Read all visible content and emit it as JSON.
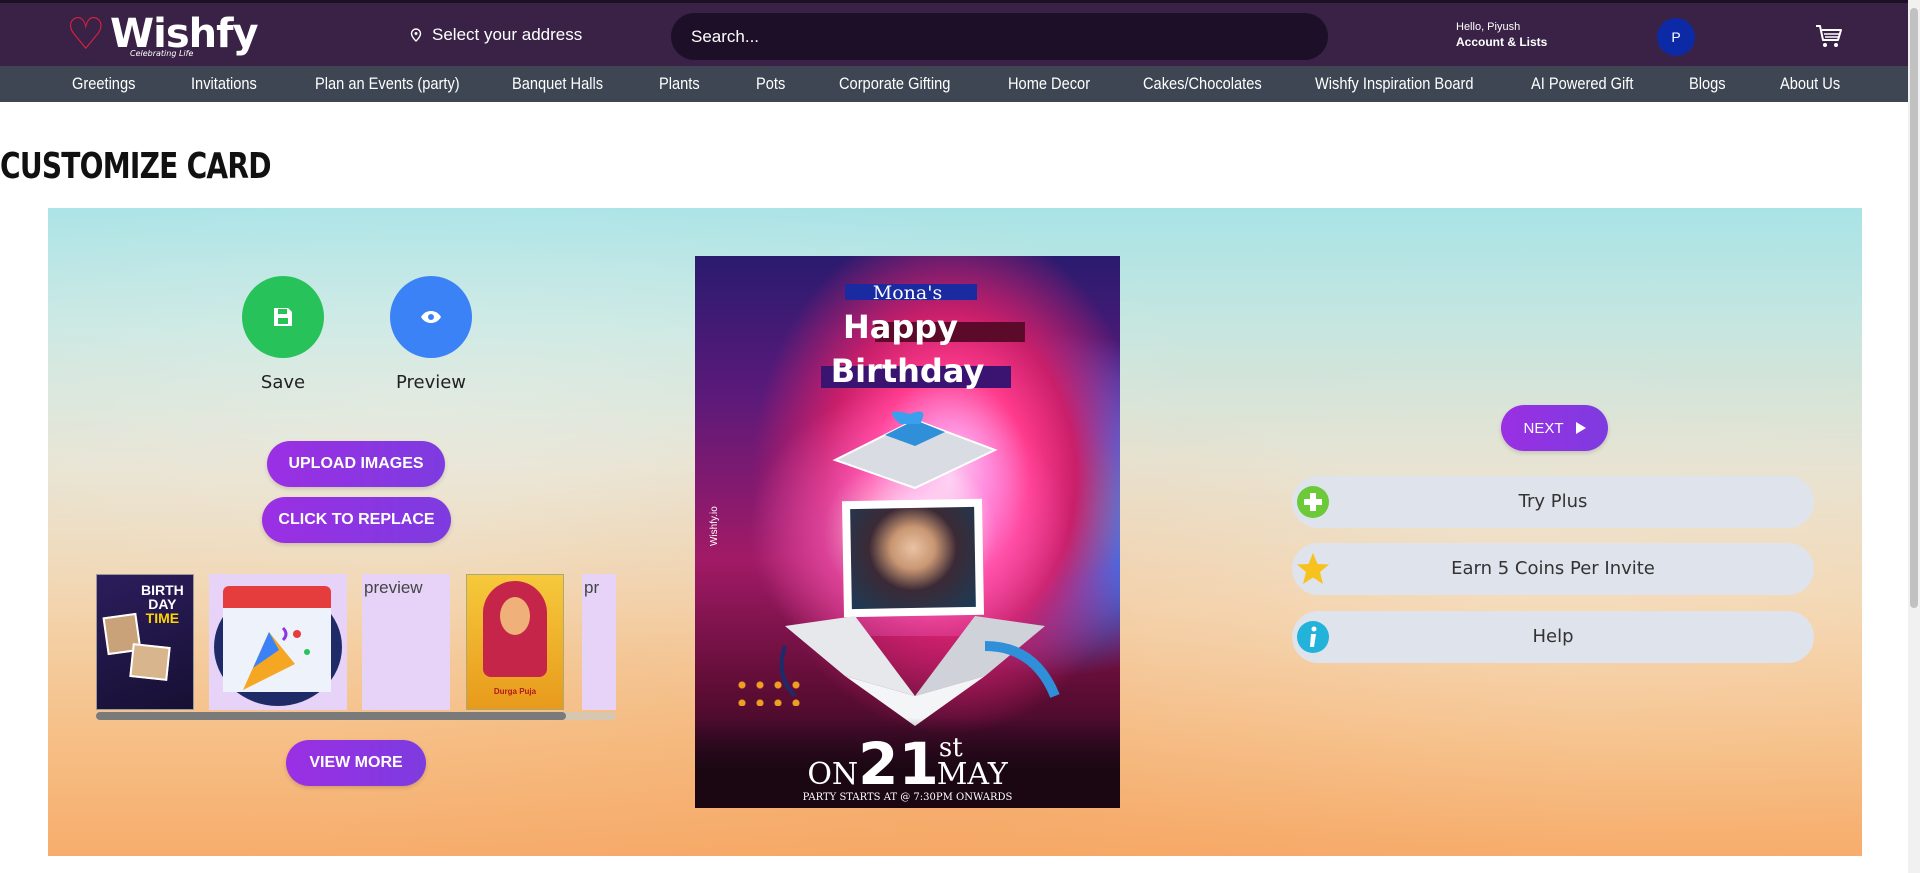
{
  "brand": {
    "logo_text": "Wishfy",
    "tagline": "Celebrating Life"
  },
  "header": {
    "address_label": "Select your address",
    "search_placeholder": "Search...",
    "account_greeting": "Hello, Piyush",
    "account_lists": "Account & Lists",
    "avatar_initial": "P"
  },
  "nav": {
    "items": [
      "Greetings",
      "Invitations",
      "Plan an Events (party)",
      "Banquet Halls",
      "Plants",
      "Pots",
      "Corporate Gifting",
      "Home Decor",
      "Cakes/Chocolates",
      "Wishfy Inspiration Board",
      "AI Powered Gift",
      "Blogs",
      "About Us"
    ]
  },
  "page": {
    "title": "CUSTOMIZE CARD"
  },
  "editor": {
    "save_label": "Save",
    "preview_label": "Preview",
    "upload_label": "UPLOAD IMAGES",
    "replace_label": "CLICK TO REPLACE",
    "view_more_label": "VIEW MORE",
    "thumb_alt": "preview",
    "thumb_alt_partial": "pr",
    "durga_text": "Durga Puja",
    "bday_text1": "BIRTH",
    "bday_text2": "DAY",
    "bday_text3": "TIME"
  },
  "card": {
    "name": "Mona's",
    "line1": "Happy",
    "line2": "Birthday",
    "on": "ON",
    "day": "21",
    "suffix": "st",
    "month": "MAY",
    "footer": "PARTY STARTS AT @ 7:30PM ONWARDS",
    "watermark": "Wishfy.io"
  },
  "sidebar": {
    "next_label": "NEXT",
    "try_plus": "Try Plus",
    "earn": "Earn 5 Coins Per Invite",
    "help": "Help"
  },
  "colors": {
    "header_bg": "#3a2247",
    "nav_bg": "#3d4652",
    "save_green": "#27c25a",
    "preview_blue": "#3b82f6",
    "pill_purple": "#8e35e2",
    "brand_red": "#e0213f"
  }
}
